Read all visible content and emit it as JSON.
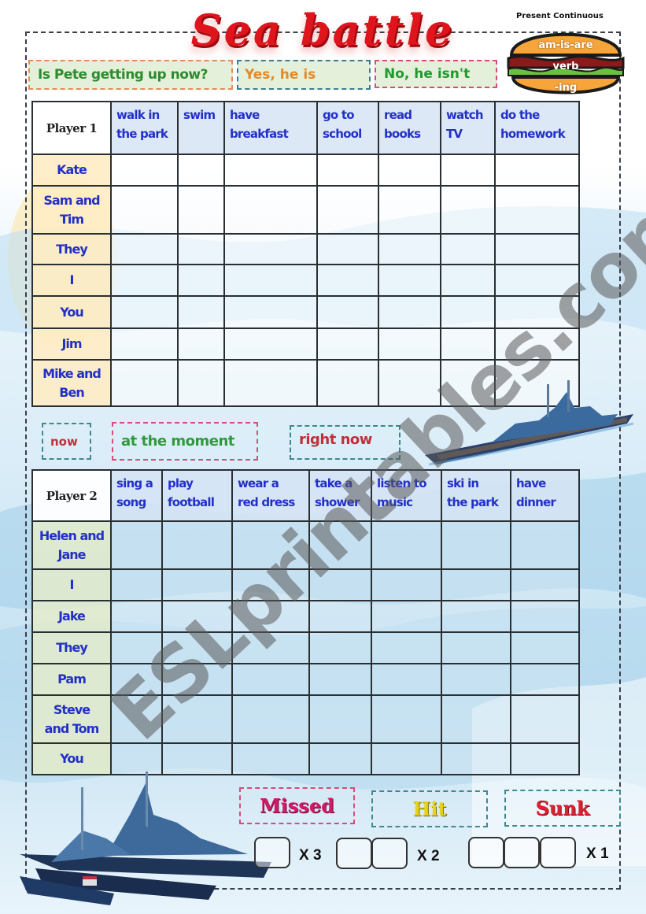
{
  "title": "Sea battle",
  "subtitle": "Present Continuous",
  "burger": {
    "top": "am-is-are",
    "middle": "verb",
    "bottom": "-ing"
  },
  "example": {
    "question": "Is Pete getting up now?",
    "positive": "Yes, he is",
    "negative": "No, he isn't"
  },
  "table1": {
    "corner": "Player 1",
    "columns": [
      [
        "walk in",
        "the park"
      ],
      [
        "swim",
        ""
      ],
      [
        "have",
        "breakfast"
      ],
      [
        "go to",
        "school"
      ],
      [
        "read",
        "books"
      ],
      [
        "watch",
        "TV"
      ],
      [
        "do the",
        "homework"
      ]
    ],
    "rows": [
      [
        "Kate",
        ""
      ],
      [
        "Sam and",
        "Tim"
      ],
      [
        "They",
        ""
      ],
      [
        "I",
        ""
      ],
      [
        "You",
        ""
      ],
      [
        "Jim",
        ""
      ],
      [
        "Mike and",
        "Ben"
      ]
    ]
  },
  "time_expressions": [
    "now",
    "at the moment",
    "right now"
  ],
  "table2": {
    "corner": "Player 2",
    "columns": [
      [
        "sing a",
        "song"
      ],
      [
        "play",
        "football"
      ],
      [
        "wear a",
        "red dress"
      ],
      [
        "take a",
        "shower"
      ],
      [
        "listen to",
        "music"
      ],
      [
        "ski in",
        "the park"
      ],
      [
        "have",
        "dinner"
      ]
    ],
    "rows": [
      [
        "Helen and",
        "Jane"
      ],
      [
        "I",
        ""
      ],
      [
        "Jake",
        ""
      ],
      [
        "They",
        ""
      ],
      [
        "Pam",
        ""
      ],
      [
        "Steve",
        "and Tom"
      ],
      [
        "You",
        ""
      ]
    ]
  },
  "legend": {
    "missed": "Missed",
    "hit": "Hit",
    "sunk": "Sunk"
  },
  "ships": [
    {
      "size": 1,
      "count_label": "X 3"
    },
    {
      "size": 2,
      "count_label": "X 2"
    },
    {
      "size": 3,
      "count_label": "X 1"
    }
  ],
  "watermark": "ESLprintables.com",
  "colors": {
    "title": "#e0141c",
    "question": "#2e8b2e",
    "positive": "#e08a2a",
    "negative": "#1f9a2e",
    "table_text": "#2330c8",
    "missed": "#d4196a",
    "hit": "#e6d21a",
    "sunk": "#e02030"
  }
}
